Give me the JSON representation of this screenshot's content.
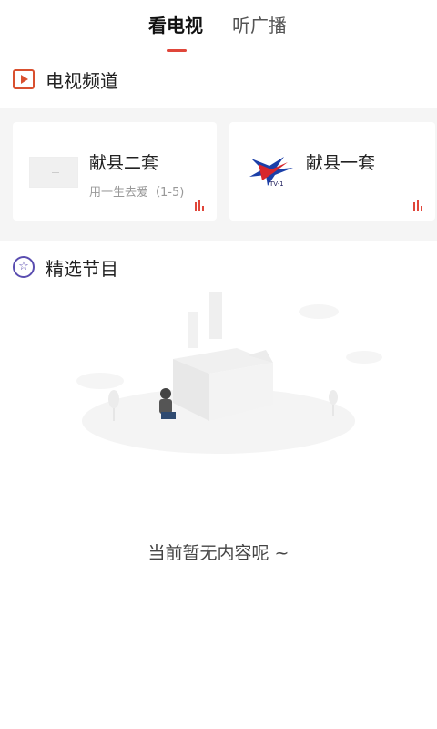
{
  "tabs": [
    {
      "label": "看电视",
      "active": true
    },
    {
      "label": "听广播",
      "active": false
    }
  ],
  "sections": {
    "tv": {
      "title": "电视频道",
      "icon": "tv-play-icon"
    },
    "featured": {
      "title": "精选节目",
      "icon": "star-icon"
    }
  },
  "channels": [
    {
      "name": "献县二套",
      "subtitle": "用一生去爱（1-5)",
      "icon": "playing-bars-icon"
    },
    {
      "name": "献县一套",
      "logo_text": "TV-1",
      "icon": "playing-bars-icon"
    }
  ],
  "empty": {
    "message": "当前暂无内容呢 ~"
  },
  "colors": {
    "accent": "#e0463a",
    "tv_icon": "#d9502f",
    "star_icon": "#5a4db0"
  }
}
